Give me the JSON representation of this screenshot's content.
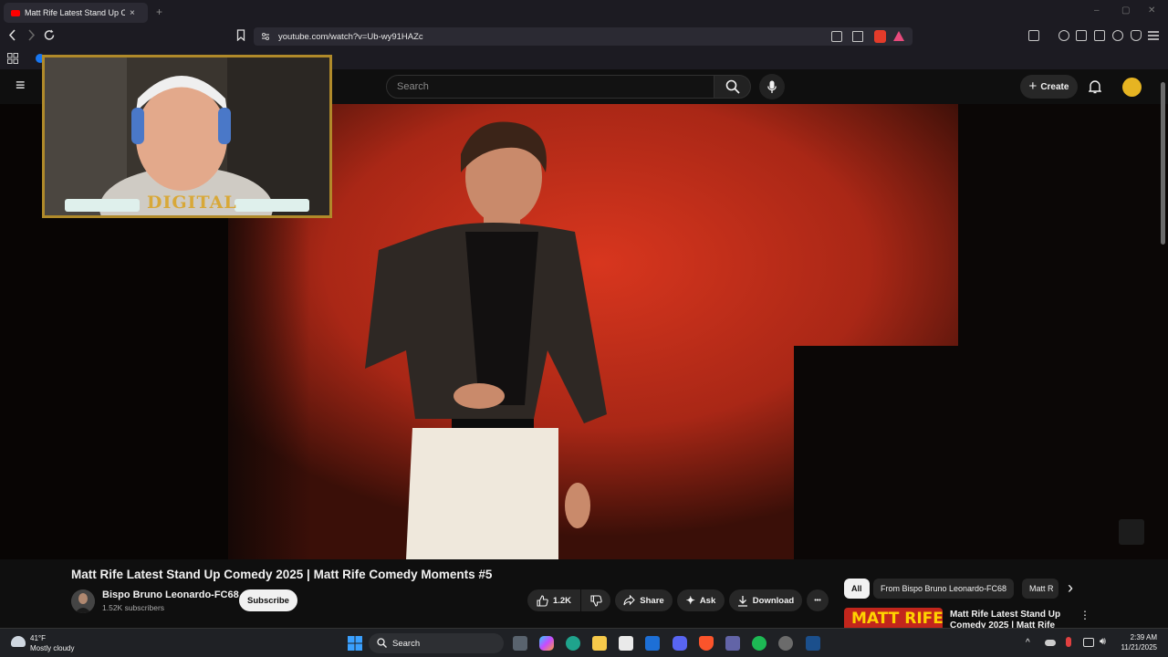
{
  "browser": {
    "tab_title": "Matt Rife Latest Stand Up Co",
    "close_glyph": "×",
    "new_tab_glyph": "+",
    "url": "youtube.com/watch?v=Ub-wy91HAZc",
    "window_controls": [
      "–",
      "▢",
      "✕"
    ]
  },
  "youtube": {
    "search_placeholder": "Search",
    "create_label": "Create",
    "menu_glyph": "≡"
  },
  "webcam_overlay": {
    "logo_text": "DIGITAL"
  },
  "video": {
    "title": "Matt Rife Latest Stand Up Comedy 2025 | Matt Rife Comedy Moments #5",
    "channel_name": "Bispo Bruno Leonardo-FC68",
    "subscribers": "1.52K subscribers",
    "subscribe_label": "Subscribe",
    "likes": "1.2K",
    "share_label": "Share",
    "ask_label": "Ask",
    "download_label": "Download",
    "more_glyph": "•••"
  },
  "sidebar": {
    "chips": [
      "All",
      "From Bispo Bruno Leonardo-FC68",
      "Matt R"
    ],
    "next_glyph": "›",
    "rec_title_line1": "Matt Rife Latest Stand Up",
    "rec_title_line2": "Comedy 2025 | Matt Rife",
    "rec_thumb_text": "MATT RIFE"
  },
  "taskbar": {
    "temperature": "41°F",
    "weather": "Mostly cloudy",
    "search_label": "Search",
    "time": "2:39 AM",
    "date": "11/21/2025"
  },
  "colors": {
    "accent": "#ff0000",
    "stage": "#c4301c",
    "webcam_frame": "#b08a2a"
  }
}
